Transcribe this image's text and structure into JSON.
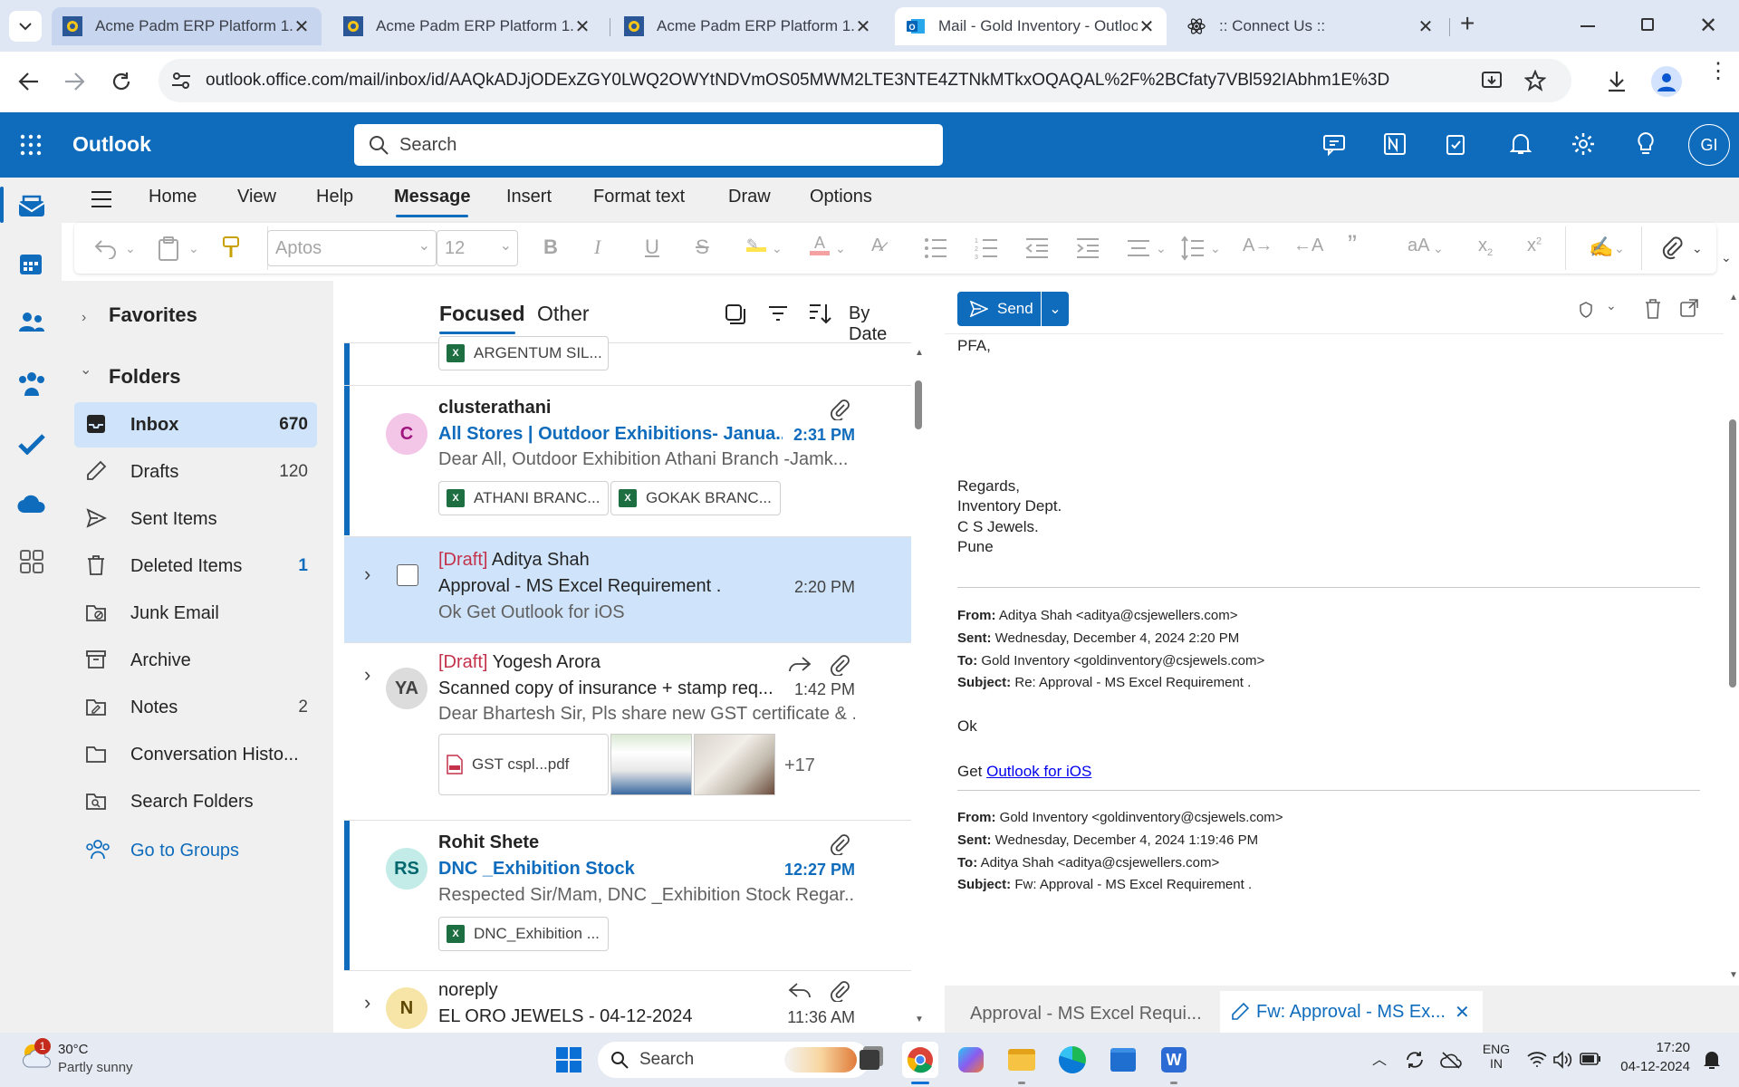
{
  "browser": {
    "tabs": [
      {
        "title": "Acme Padm ERP Platform 1.00",
        "active": false
      },
      {
        "title": "Acme Padm ERP Platform 1.00",
        "active": false
      },
      {
        "title": "Acme Padm ERP Platform 1.00",
        "active": false
      },
      {
        "title": "Mail - Gold Inventory - Outlook",
        "active": true
      },
      {
        "title": ":: Connect Us ::",
        "active": false
      }
    ],
    "new_tab": "+",
    "url": "outlook.office.com/mail/inbox/id/AAQkADJjODExZGY0LWQ2OWYtNDVmOS05MWM2LTE3NTE4ZTNkMTkxOQAQAL%2F%2BCfaty7VBl592IAbhm1E%3D"
  },
  "outlook": {
    "app_name": "Outlook",
    "search_placeholder": "Search",
    "avatar_initials": "GI",
    "accent": "#0f6cbd"
  },
  "ribbon": {
    "tabs": [
      "Home",
      "View",
      "Help",
      "Message",
      "Insert",
      "Format text",
      "Draw",
      "Options"
    ],
    "active_tab": "Message",
    "font_name": "Aptos",
    "font_size": "12"
  },
  "folders": {
    "favorites_label": "Favorites",
    "folders_label": "Folders",
    "items": [
      {
        "label": "Inbox",
        "count": "670",
        "selected": true
      },
      {
        "label": "Drafts",
        "count": "120"
      },
      {
        "label": "Sent Items",
        "count": ""
      },
      {
        "label": "Deleted Items",
        "count": "1"
      },
      {
        "label": "Junk Email",
        "count": ""
      },
      {
        "label": "Archive",
        "count": ""
      },
      {
        "label": "Notes",
        "count": "2"
      },
      {
        "label": "Conversation Histo...",
        "count": ""
      },
      {
        "label": "Search Folders",
        "count": ""
      }
    ],
    "groups_link": "Go to Groups"
  },
  "list": {
    "tab_focused": "Focused",
    "tab_other": "Other",
    "sort_label": "By Date",
    "top_chip": "ARGENTUM SIL...",
    "messages": [
      {
        "avatar": "C",
        "sender": "clusterathani",
        "draft": "",
        "subject": "All Stores | Outdoor Exhibitions- Janua...",
        "time": "2:31 PM",
        "preview": "Dear All, Outdoor Exhibition Athani Branch -Jamk...",
        "chips": [
          "ATHANI BRANC...",
          "GOKAK BRANC..."
        ]
      },
      {
        "avatar": "",
        "sender": "Aditya Shah",
        "draft": "[Draft]",
        "subject": "Approval - MS Excel Requirement .",
        "time": "2:20 PM",
        "preview": "Ok Get Outlook for iOS",
        "chips": []
      },
      {
        "avatar": "YA",
        "sender": "Yogesh Arora",
        "draft": "[Draft]",
        "subject": "Scanned copy of insurance + stamp req...",
        "time": "1:42 PM",
        "preview": "Dear Bhartesh Sir, Pls share new GST certificate & ...",
        "chips": [
          "GST cspl...pdf"
        ],
        "more": "+17"
      },
      {
        "avatar": "RS",
        "sender": "Rohit Shete",
        "draft": "",
        "subject": "DNC _Exhibition Stock",
        "time": "12:27 PM",
        "preview": "Respected Sir/Mam, DNC _Exhibition Stock Regar...",
        "chips": [
          "DNC_Exhibition ..."
        ]
      },
      {
        "avatar": "N",
        "sender": "noreply",
        "draft": "",
        "subject": "EL ORO JEWELS - 04-12-2024",
        "time": "11:36 AM",
        "preview": "",
        "chips": []
      }
    ]
  },
  "compose": {
    "send_label": "Send",
    "body_lines": [
      "PFA,",
      "Regards,",
      "Inventory Dept.",
      "C S Jewels.",
      "Pune"
    ],
    "quote1": {
      "from_label": "From:",
      "from": "Aditya Shah <aditya@csjewellers.com>",
      "sent_label": "Sent:",
      "sent": "Wednesday, December 4, 2024 2:20 PM",
      "to_label": "To:",
      "to": "Gold Inventory <goldinventory@csjewels.com>",
      "subject_label": "Subject:",
      "subject": "Re: Approval - MS Excel Requirement ."
    },
    "ok": "Ok",
    "get_text": "Get ",
    "get_link": "Outlook for iOS",
    "quote2": {
      "from_label": "From:",
      "from": "Gold Inventory <goldinventory@csjewels.com>",
      "sent_label": "Sent:",
      "sent": "Wednesday, December 4, 2024 1:19:46 PM",
      "to_label": "To:",
      "to": "Aditya Shah <aditya@csjewellers.com>",
      "subject_label": "Subject:",
      "subject": "Fw: Approval - MS Excel Requirement ."
    },
    "bottom_tab1": "Approval - MS Excel Requi...",
    "bottom_tab2": "Fw: Approval - MS Ex..."
  },
  "taskbar": {
    "weather_temp": "30°C",
    "weather_desc": "Partly sunny",
    "weather_badge": "1",
    "search_label": "Search",
    "lang1": "ENG",
    "lang2": "IN",
    "time": "17:20",
    "date": "04-12-2024"
  }
}
